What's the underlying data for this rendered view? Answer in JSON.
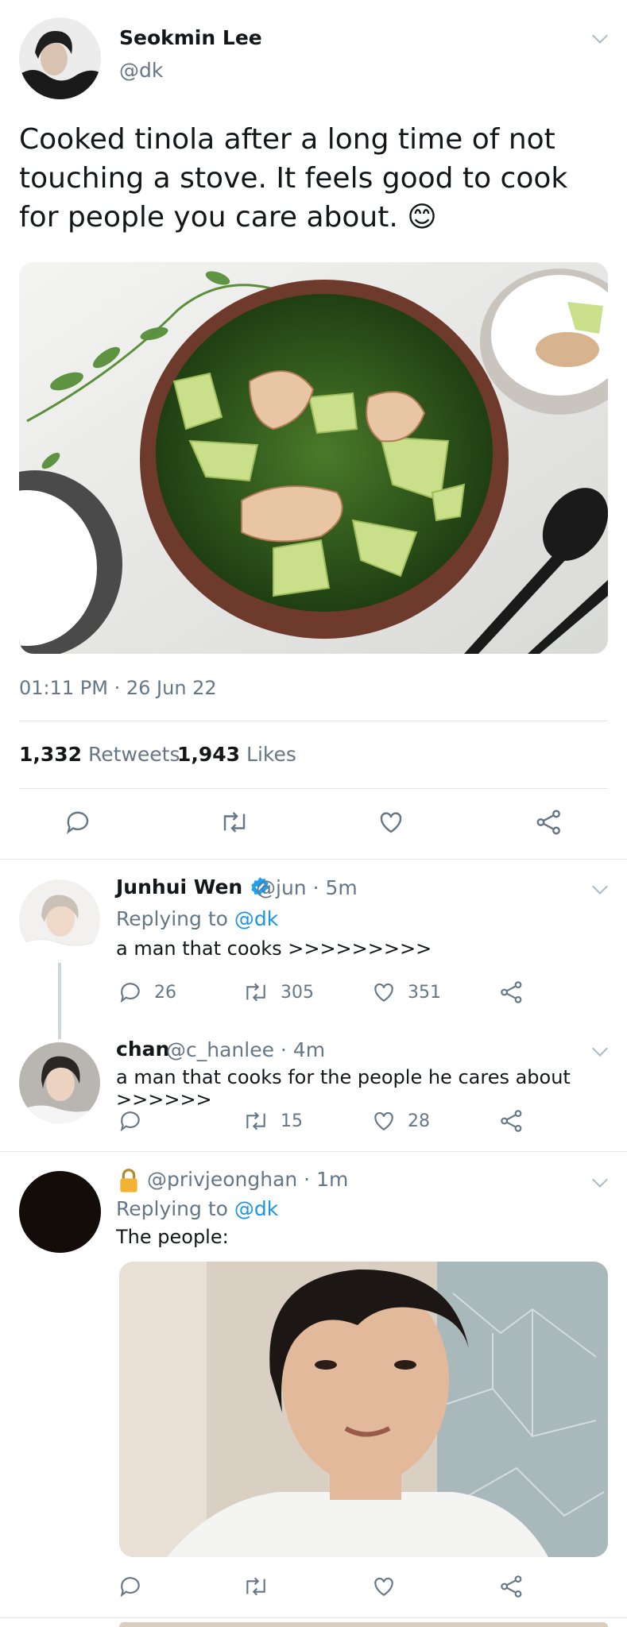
{
  "main_tweet": {
    "name": "Seokmin Lee",
    "handle": "@dk",
    "text": "Cooked tinola after a long time of not touching a stove. It feels good to cook for people you care about. 😊",
    "timestamp": "01:11 PM · 26 Jun 22",
    "retweets_count": "1,332",
    "retweets_label": "Retweets",
    "likes_count": "1,943",
    "likes_label": "Likes"
  },
  "replies": [
    {
      "name": "Junhui Wen",
      "handle_time": "@jun · 5m",
      "replying_prefix": "Replying to",
      "replying_to": "@dk",
      "text": "a man that cooks >>>>>>>>>",
      "reply_count": "26",
      "retweet_count": "305",
      "like_count": "351"
    },
    {
      "name": "chan",
      "handle_time": "@c_hanlee · 4m",
      "text": "a man that cooks for the people he cares about >>>>>>",
      "retweet_count": "15",
      "like_count": "28"
    },
    {
      "handle_time": "@privjeonghan · 1m",
      "replying_prefix": "Replying to",
      "replying_to": "@dk",
      "text": "The people:"
    }
  ],
  "colors": {
    "accent": "#1b95e0",
    "secondary_text": "#657786",
    "divider": "#e1e8ed",
    "verified": "#1da1f2"
  }
}
